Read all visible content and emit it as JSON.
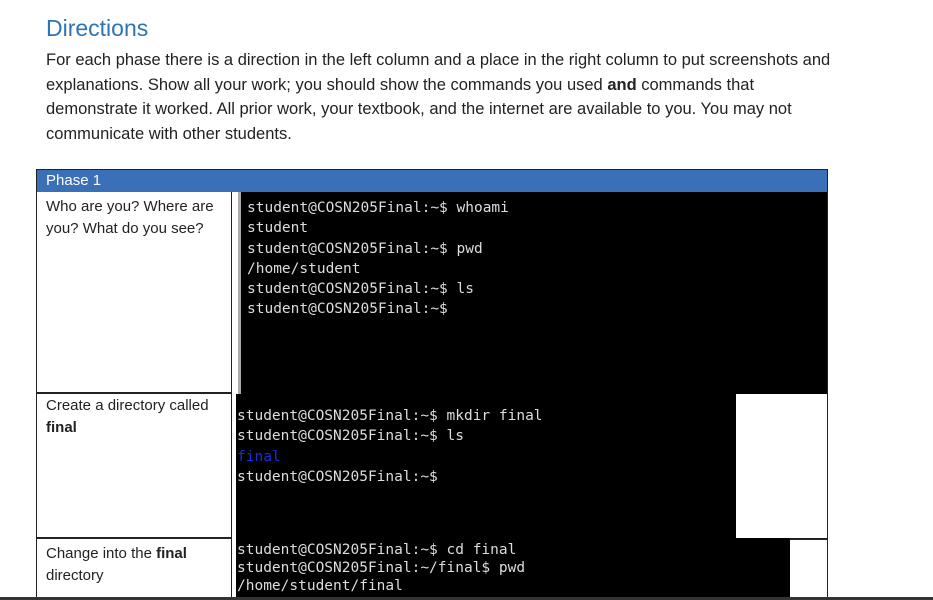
{
  "heading": "Directions",
  "intro": {
    "part1": "For each phase there is a direction in the left column and a place in the right column to put screenshots and explanations.  Show all your work;  you should show the commands you used ",
    "bold": "and",
    "part2": " commands that demonstrate it worked.  All prior work, your textbook, and the internet are available to you.  You may not communicate with other students."
  },
  "table": {
    "phase_label": "Phase 1",
    "rows": [
      {
        "direction": "Who are you?  Where are you?  What do you see?",
        "terminal": [
          "student@COSN205Final:~$ whoami",
          "student",
          "student@COSN205Final:~$ pwd",
          "/home/student",
          "student@COSN205Final:~$ ls",
          "student@COSN205Final:~$"
        ]
      },
      {
        "direction_pre": "Create a directory called ",
        "direction_bold": "final",
        "terminal": [
          "student@COSN205Final:~$ mkdir final",
          "student@COSN205Final:~$ ls",
          "final",
          "student@COSN205Final:~$"
        ]
      },
      {
        "direction_pre": "Change into the ",
        "direction_bold": "final",
        "direction_post": " directory",
        "terminal": [
          "student@COSN205Final:~$ cd final",
          "student@COSN205Final:~/final$ pwd",
          "/home/student/final"
        ]
      }
    ]
  },
  "colors": {
    "heading": "#2e74b5",
    "phase_bar": "#3a70b8",
    "dir_listing": "#1a2ce0"
  }
}
